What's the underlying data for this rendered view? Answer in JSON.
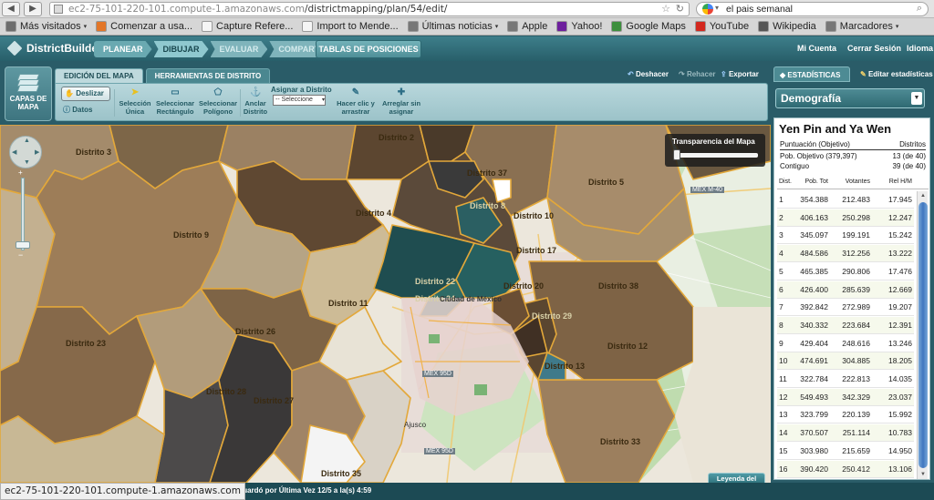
{
  "browser": {
    "url_host": "ec2-75-101-220-101.compute-1.amazonaws.com",
    "url_path": "/districtmapping/plan/54/edit/",
    "search_text": "el pais semanal",
    "status_url": "ec2-75-101-220-101.compute-1.amazonaws.com"
  },
  "bookmarks": [
    {
      "label": "Más visitados",
      "dropdown": true,
      "color": "#6d6d6d"
    },
    {
      "label": "Comenzar a usa...",
      "dropdown": false,
      "color": "#e37628"
    },
    {
      "label": "Capture Refere...",
      "dropdown": false,
      "color": "#f5f5f5"
    },
    {
      "label": "Import to Mende...",
      "dropdown": false,
      "color": "#f5f5f5"
    },
    {
      "label": "Últimas noticias",
      "dropdown": true,
      "color": "#777777"
    },
    {
      "label": "Apple",
      "dropdown": false,
      "color": "#777777"
    },
    {
      "label": "Yahoo!",
      "dropdown": false,
      "color": "#6d1f9d"
    },
    {
      "label": "Google Maps",
      "dropdown": false,
      "color": "#3d8f3d"
    },
    {
      "label": "YouTube",
      "dropdown": false,
      "color": "#d3281e"
    },
    {
      "label": "Wikipedia",
      "dropdown": false,
      "color": "#555555"
    },
    {
      "label": "Marcadores",
      "dropdown": true,
      "color": "#777777"
    }
  ],
  "app": {
    "logo": "DistrictBuilder",
    "steps": [
      "PLANEAR",
      "DIBUJAR",
      "EVALUAR",
      "COMPARTIR"
    ],
    "tablas_button": "TABLAS DE POSICIONES",
    "header_links": [
      "Mi Cuenta",
      "Cerrar Sesión",
      "Idioma"
    ]
  },
  "toolbar": {
    "capas_label": "CAPAS DE MAPA",
    "tabs": [
      "EDICIÓN DEL MAPA",
      "HERRAMIENTAS DE DISTRITO"
    ],
    "deslizar": "Deslizar",
    "datos": "Datos",
    "seleccion_unica": "Selección Única",
    "seleccionar_rectangulo": "Seleccionar Rectángulo",
    "seleccionar_poligono": "Seleccionar Polígono",
    "anclar_distrito": "Anclar Distrito",
    "asignar_label": "Asignar a Distrito",
    "asignar_select": "-- Seleccione",
    "hacer_clic": "Hacer clic y arrastrar",
    "arreglar": "Arreglar sin asignar",
    "deshacer": "Deshacer",
    "rehacer": "Rehacer",
    "exportar": "Exportar"
  },
  "map": {
    "transparency_label": "Transparencia del Mapa",
    "transparency_value": 0,
    "legend_button": "Leyenda del mapa",
    "district_labels": [
      "Distrito 2",
      "Distrito 3",
      "Distrito 37",
      "Distrito 4",
      "Distrito 5",
      "Distrito 9",
      "Distrito 10",
      "Distrito 17",
      "Distrito 22",
      "Distrito 24",
      "Distrito 20",
      "Distrito 38",
      "Distrito 11",
      "Distrito 23",
      "Distrito 26",
      "Distrito 12",
      "Distrito 28",
      "Distrito 27",
      "Distrito 13",
      "Distrito 33",
      "Distrito 35",
      "Distrito 8",
      "Distrito 29"
    ],
    "place_labels": [
      "Ciudad de México",
      "MEX M-40",
      "MEX 95D",
      "MEX 95D",
      "Ajusco"
    ]
  },
  "status": {
    "principio": "incipio",
    "saved": "Guardó por Última Vez 12/5 a la(s) 4:59"
  },
  "panel": {
    "tabs": [
      "ESTADÍSTICAS",
      "Editar estadísticas"
    ],
    "selector": "Demografía",
    "plan_name": "Yen Pin and Ya Wen",
    "score_header": "Puntuación (Objetivo)",
    "score_header_right": "Distritos",
    "pob_label": "Pob. Objetivo (379,397)",
    "pob_value": "13 (de 40)",
    "contiguo_label": "Contiguo",
    "contiguo_value": "39 (de 40)",
    "columns": [
      "Dist.",
      "Pob. Tot",
      "Votantes",
      "Rel H/M"
    ],
    "rows": [
      [
        "1",
        "354.388",
        "212.483",
        "17.945"
      ],
      [
        "2",
        "406.163",
        "250.298",
        "12.247"
      ],
      [
        "3",
        "345.097",
        "199.191",
        "15.242"
      ],
      [
        "4",
        "484.586",
        "312.256",
        "13.222"
      ],
      [
        "5",
        "465.385",
        "290.806",
        "17.476"
      ],
      [
        "6",
        "426.400",
        "285.639",
        "12.669"
      ],
      [
        "7",
        "392.842",
        "272.989",
        "19.207"
      ],
      [
        "8",
        "340.332",
        "223.684",
        "12.391"
      ],
      [
        "9",
        "429.404",
        "248.616",
        "13.246"
      ],
      [
        "10",
        "474.691",
        "304.885",
        "18.205"
      ],
      [
        "11",
        "322.784",
        "222.813",
        "14.035"
      ],
      [
        "12",
        "549.493",
        "342.329",
        "23.037"
      ],
      [
        "13",
        "323.799",
        "220.139",
        "15.992"
      ],
      [
        "14",
        "370.507",
        "251.114",
        "10.783"
      ],
      [
        "15",
        "303.980",
        "215.659",
        "14.950"
      ],
      [
        "16",
        "390.420",
        "250.412",
        "13.106"
      ]
    ]
  }
}
